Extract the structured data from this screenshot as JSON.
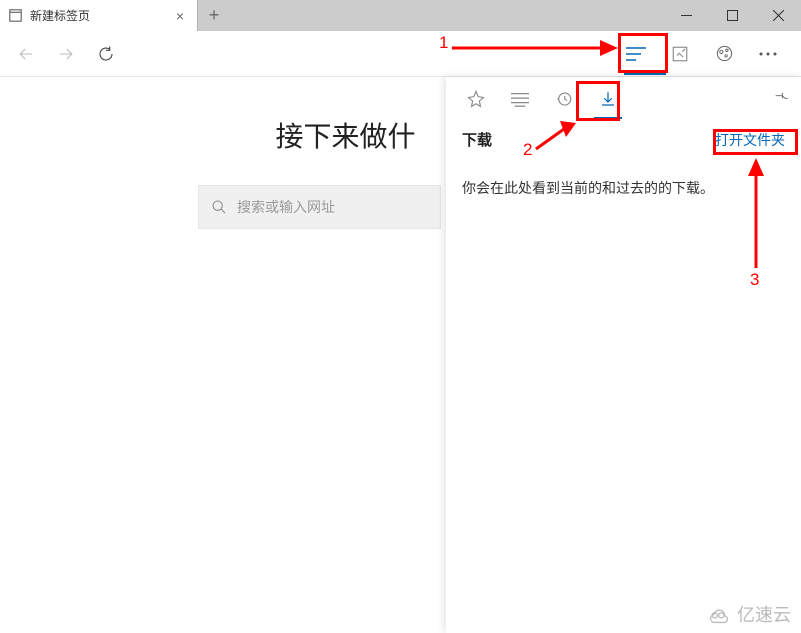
{
  "tab": {
    "title": "新建标签页"
  },
  "page": {
    "heading": "接下来做什",
    "search_placeholder": "搜索或输入网址"
  },
  "hub": {
    "title": "下载",
    "open_folder": "打开文件夹",
    "empty_text": "你会在此处看到当前的和过去的的下载。"
  },
  "annotations": {
    "n1": "1",
    "n2": "2",
    "n3": "3"
  },
  "watermark": {
    "text": "亿速云"
  }
}
